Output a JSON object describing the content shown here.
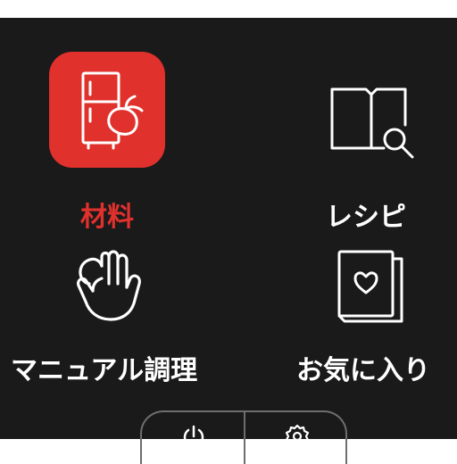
{
  "colors": {
    "accent": "#e0312d",
    "background": "#1a1a1a",
    "foreground": "#ffffff",
    "border": "#6e6e6e"
  },
  "menu": {
    "items": [
      {
        "id": "ingredients",
        "label": "材料",
        "icon": "fridge-vegetable-icon",
        "active": true
      },
      {
        "id": "recipes",
        "label": "レシピ",
        "icon": "recipe-book-search-icon",
        "active": false
      },
      {
        "id": "manual",
        "label": "マニュアル調理",
        "icon": "hand-icon",
        "active": false
      },
      {
        "id": "favorites",
        "label": "お気に入り",
        "icon": "heart-book-icon",
        "active": false
      }
    ]
  },
  "bottom_bar": {
    "buttons": [
      {
        "icon": "power-icon"
      },
      {
        "icon": "gear-icon"
      }
    ]
  }
}
